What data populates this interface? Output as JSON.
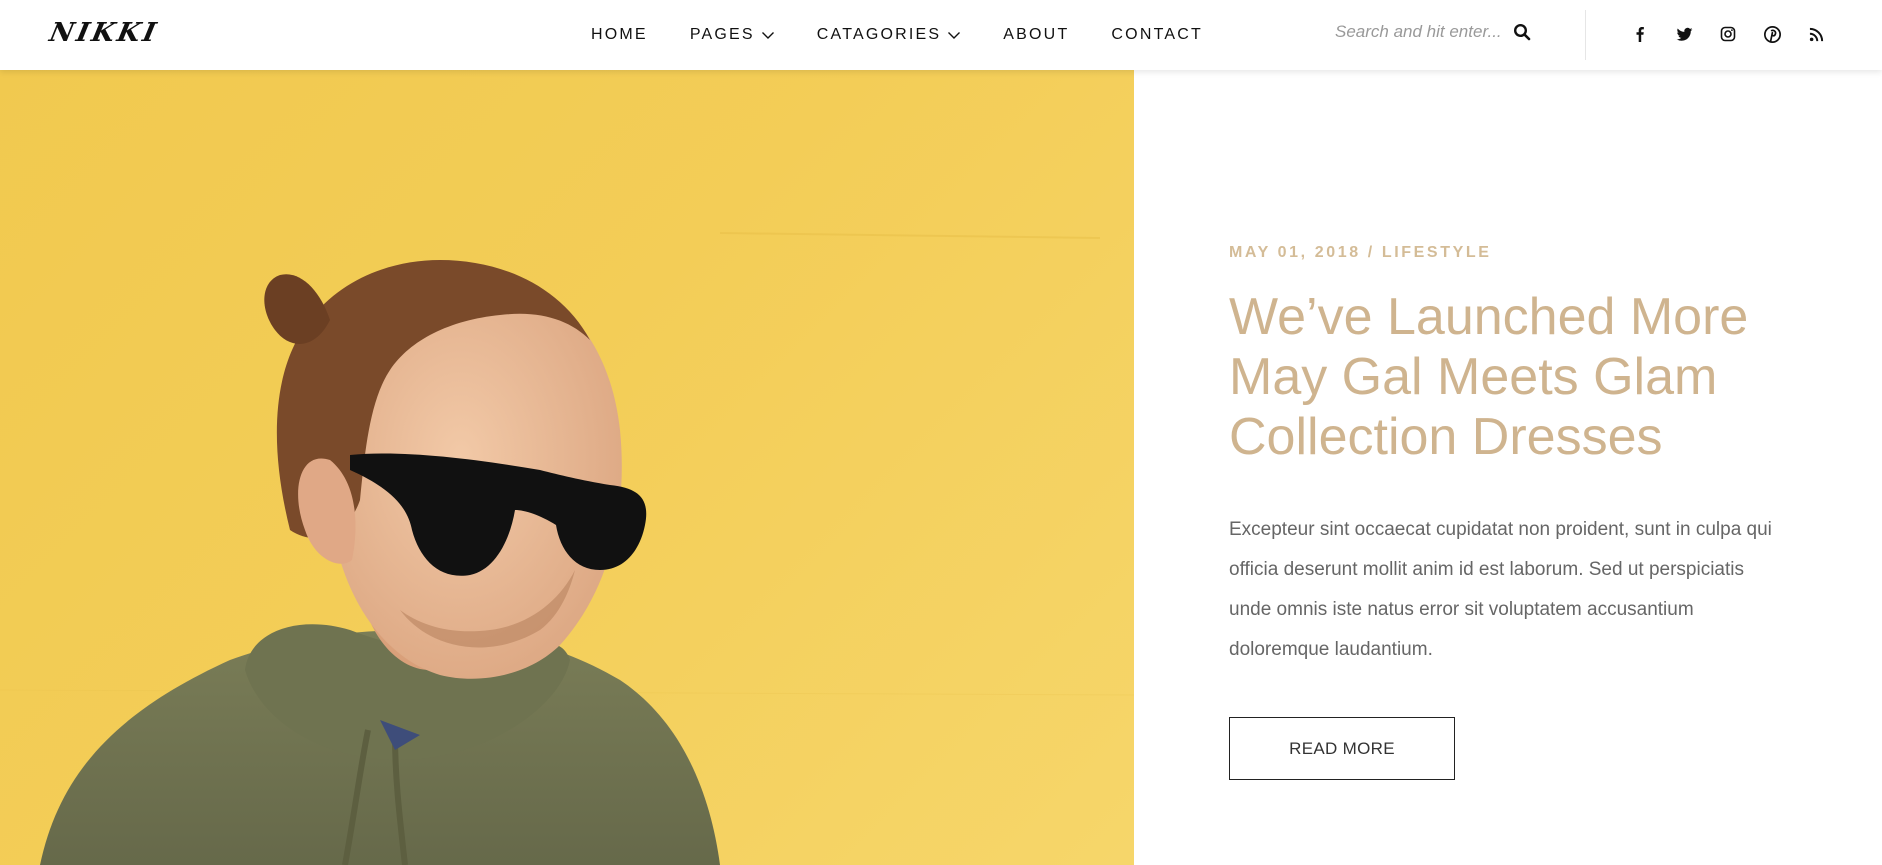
{
  "header": {
    "logo": "NIKKI",
    "nav": [
      {
        "label": "HOME",
        "dropdown": false
      },
      {
        "label": "PAGES",
        "dropdown": true
      },
      {
        "label": "CATAGORIES",
        "dropdown": true
      },
      {
        "label": "ABOUT",
        "dropdown": false
      },
      {
        "label": "CONTACT",
        "dropdown": false
      }
    ],
    "search": {
      "placeholder": "Search and hit enter..."
    },
    "social": [
      "facebook-icon",
      "twitter-icon",
      "instagram-icon",
      "pinterest-icon",
      "rss-icon"
    ]
  },
  "post": {
    "meta": "MAY 01, 2018 / LIFESTYLE",
    "title": "We’ve Launched More May Gal Meets Glam Collection Dresses",
    "excerpt": "Excepteur sint occaecat cupidatat non proident, sunt in culpa qui officia deserunt mollit anim id est laborum. Sed ut perspiciatis unde omnis iste natus error sit voluptatem accusantium doloremque laudantium.",
    "read_more": "READ MORE"
  },
  "colors": {
    "accent": "#cfb48f",
    "hero_background": "#f3cd57"
  }
}
